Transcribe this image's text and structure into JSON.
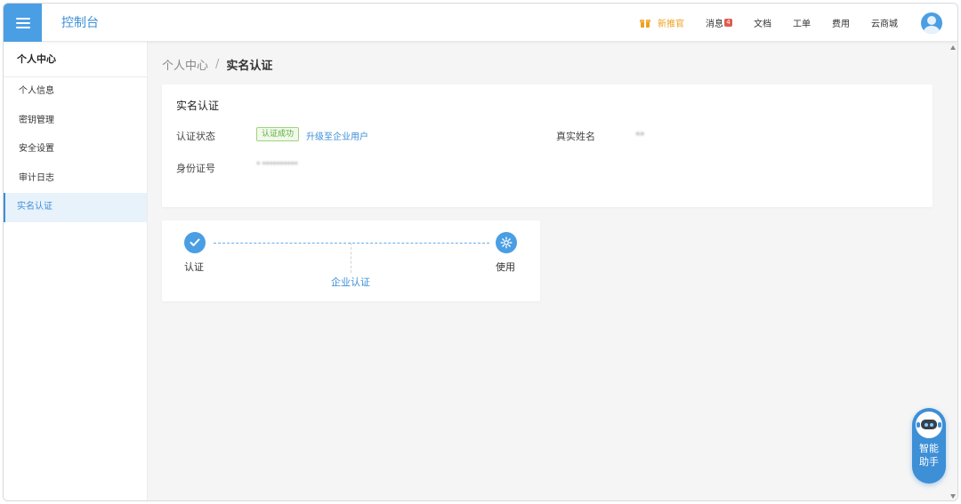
{
  "header": {
    "app_title": "控制台",
    "nav": {
      "promo": "新推官",
      "messages": "消息",
      "message_count": "4",
      "docs": "文档",
      "tickets": "工单",
      "billing": "费用",
      "marketplace": "云商城"
    }
  },
  "sidebar": {
    "title": "个人中心",
    "items": [
      {
        "label": "个人信息"
      },
      {
        "label": "密钥管理"
      },
      {
        "label": "安全设置"
      },
      {
        "label": "审计日志"
      },
      {
        "label": "实名认证"
      }
    ]
  },
  "breadcrumb": {
    "parent": "个人中心",
    "separator": "/",
    "current": "实名认证"
  },
  "info_card": {
    "title": "实名认证",
    "status_label": "认证状态",
    "status_value": "认证成功",
    "upgrade_link": "升级至企业用户",
    "real_name_label": "真实姓名",
    "real_name_value": "**",
    "id_label": "身份证号",
    "id_value": "* **********"
  },
  "steps": {
    "step1": "认证",
    "step2": "使用",
    "middle": "企业认证"
  },
  "assistant": {
    "line1": "智能",
    "line2": "助手"
  },
  "colors": {
    "primary": "#4a9ee3",
    "link": "#3d8fd6",
    "promo": "#f0a020",
    "success": "#5ab03b",
    "badge": "#e05a4e"
  }
}
